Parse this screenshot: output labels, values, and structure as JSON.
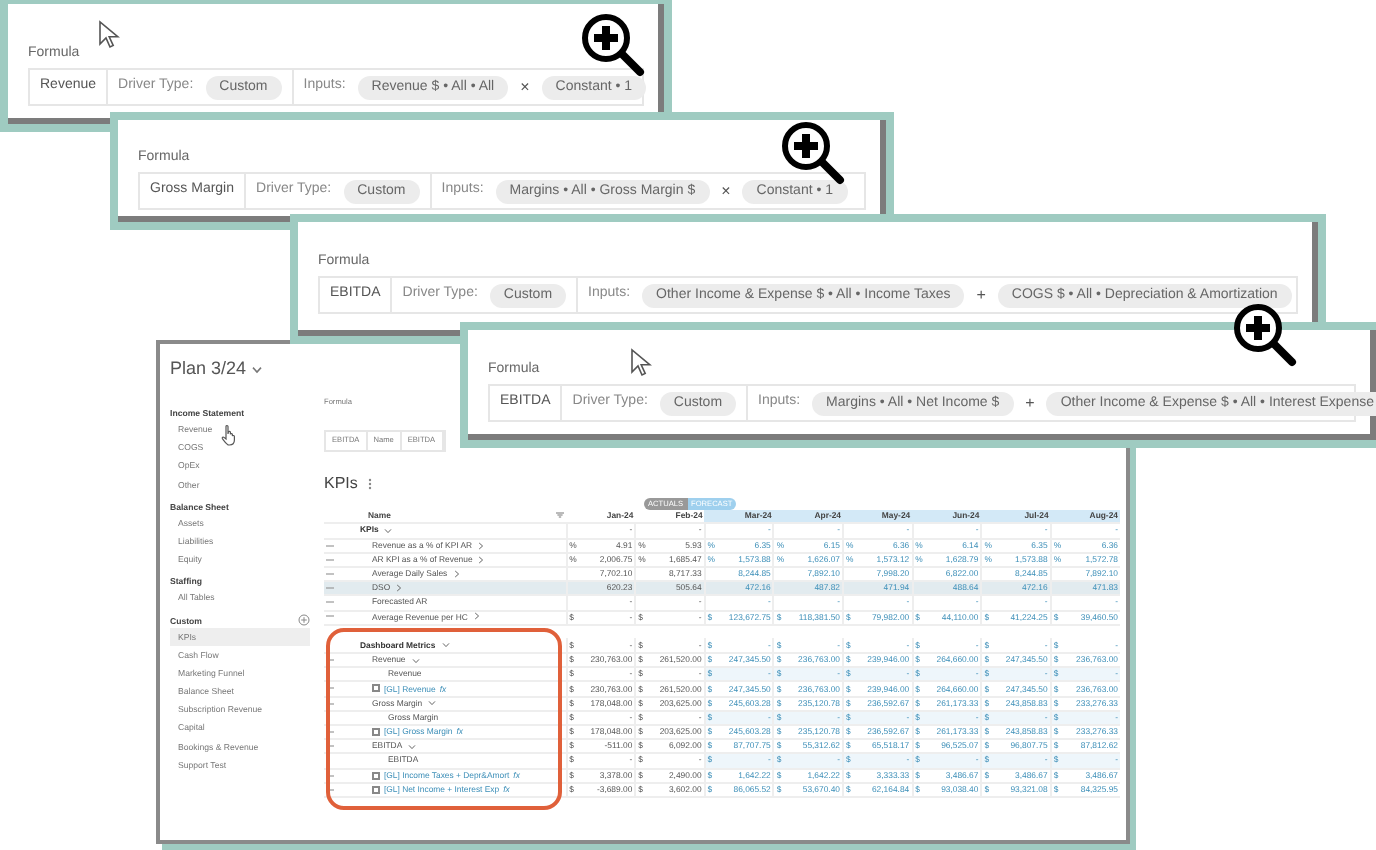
{
  "formula_panels": [
    {
      "title": "Formula",
      "name": "Revenue",
      "driver_label": "Driver Type:",
      "driver_type": "Custom",
      "inputs_label": "Inputs:",
      "inputs": [
        "Revenue $ • All • All",
        "Constant • 1"
      ],
      "operator": "×"
    },
    {
      "title": "Formula",
      "name": "Gross Margin",
      "driver_label": "Driver Type:",
      "driver_type": "Custom",
      "inputs_label": "Inputs:",
      "inputs": [
        "Margins • All • Gross Margin $",
        "Constant • 1"
      ],
      "operator": "×"
    },
    {
      "title": "Formula",
      "name": "EBITDA",
      "driver_label": "Driver Type:",
      "driver_type": "Custom",
      "inputs_label": "Inputs:",
      "inputs": [
        "Other Income & Expense $ • All • Income Taxes",
        "COGS $ • All • Depreciation & Amortization"
      ],
      "operator": "+"
    },
    {
      "title": "Formula",
      "name": "EBITDA",
      "driver_label": "Driver Type:",
      "driver_type": "Custom",
      "inputs_label": "Inputs:",
      "inputs": [
        "Margins • All • Net Income $",
        "Other Income & Expense $ • All • Interest Expense"
      ],
      "operator": "+"
    }
  ],
  "app": {
    "plan_title": "Plan 3/24",
    "sidebar": [
      {
        "heading": "Income Statement",
        "add_button": false,
        "items": [
          {
            "label": "Revenue",
            "selected": false
          },
          {
            "label": "COGS",
            "selected": false
          },
          {
            "label": "OpEx",
            "selected": false
          },
          {
            "label": "Other",
            "selected": false
          }
        ]
      },
      {
        "heading": "Balance Sheet",
        "add_button": false,
        "items": [
          {
            "label": "Assets",
            "selected": false
          },
          {
            "label": "Liabilities",
            "selected": false
          },
          {
            "label": "Equity",
            "selected": false
          }
        ]
      },
      {
        "heading": "Staffing",
        "add_button": false,
        "items": [
          {
            "label": "All Tables",
            "selected": false
          }
        ]
      },
      {
        "heading": "Custom",
        "add_button": true,
        "items": [
          {
            "label": "KPIs",
            "selected": true
          },
          {
            "label": "Cash Flow",
            "selected": false
          },
          {
            "label": "Marketing Funnel",
            "selected": false
          },
          {
            "label": "Balance Sheet",
            "selected": false
          },
          {
            "label": "Subscription Revenue",
            "selected": false
          },
          {
            "label": "Capital",
            "selected": false
          },
          {
            "label": "Bookings & Revenue",
            "selected": false
          },
          {
            "label": "Support Test",
            "selected": false
          }
        ]
      }
    ],
    "formula": {
      "title": "Formula",
      "cells": [
        "EBITDA",
        "Name",
        "EBITDA"
      ]
    },
    "page_title": "KPIs",
    "view_toggle": [
      {
        "label": "ACTUALS",
        "selected": false
      },
      {
        "label": "FORECAST",
        "selected": true
      }
    ],
    "table": {
      "name_column": "Name",
      "columns": [
        {
          "label": "Jan-24",
          "forecast": false
        },
        {
          "label": "Feb-24",
          "forecast": false
        },
        {
          "label": "Mar-24",
          "forecast": true
        },
        {
          "label": "Apr-24",
          "forecast": true
        },
        {
          "label": "May-24",
          "forecast": true
        },
        {
          "label": "Jun-24",
          "forecast": true
        },
        {
          "label": "Jul-24",
          "forecast": true
        },
        {
          "label": "Aug-24",
          "forecast": true
        }
      ],
      "rows": [
        {
          "kind": "section",
          "label": "KPIs",
          "expanded": true,
          "handle": false,
          "selected": false,
          "values": [
            "-",
            "-",
            "-",
            "-",
            "-",
            "-",
            "-",
            "-"
          ],
          "children": [
            {
              "kind": "metric",
              "label": "Revenue as a % of KPI AR",
              "expanded": false,
              "handle": true,
              "selected": false,
              "unit": "%",
              "values": [
                "4.91",
                "5.93",
                "6.35",
                "6.15",
                "6.36",
                "6.14",
                "6.35",
                "6.36"
              ]
            },
            {
              "kind": "metric",
              "label": "AR KPI as a % of Revenue",
              "expanded": false,
              "handle": true,
              "selected": false,
              "unit": "%",
              "values": [
                "2,006.75",
                "1,685.47",
                "1,573.88",
                "1,626.07",
                "1,573.12",
                "1,628.79",
                "1,573.88",
                "1,572.78"
              ]
            },
            {
              "kind": "metric",
              "label": "Average Daily Sales",
              "expanded": false,
              "handle": true,
              "selected": false,
              "values": [
                "7,702.10",
                "8,717.33",
                "8,244.85",
                "7,892.10",
                "7,998.20",
                "6,822.00",
                "8,244.85",
                "7,892.10"
              ]
            },
            {
              "kind": "metric",
              "label": "DSO",
              "expanded": false,
              "handle": true,
              "selected": true,
              "values": [
                "620.23",
                "505.64",
                "472.16",
                "487.82",
                "471.94",
                "488.64",
                "472.16",
                "471.83"
              ]
            },
            {
              "kind": "metric",
              "label": "Forecasted AR",
              "handle": true,
              "selected": false,
              "values": [
                "-",
                "-",
                "-",
                "-",
                "-",
                "-",
                "-",
                "-"
              ]
            },
            {
              "kind": "metric",
              "label": "Average Revenue per HC",
              "expanded": false,
              "handle": true,
              "selected": false,
              "unit": "$",
              "values": [
                "-",
                "-",
                "123,672.75",
                "118,381.50",
                "79,982.00",
                "44,110.00",
                "41,224.25",
                "39,460.50"
              ]
            }
          ]
        },
        {
          "kind": "section",
          "label": "Dashboard Metrics",
          "expanded": true,
          "handle": false,
          "selected": false,
          "unit": "$",
          "values": [
            "-",
            "-",
            "-",
            "-",
            "-",
            "-",
            "-",
            "-"
          ],
          "children": [
            {
              "kind": "metric",
              "label": "Revenue",
              "expanded": true,
              "handle": true,
              "selected": false,
              "unit": "$",
              "values": [
                "230,763.00",
                "261,520.00",
                "247,345.50",
                "236,763.00",
                "239,946.00",
                "264,660.00",
                "247,345.50",
                "236,763.00"
              ],
              "children": [
                {
                  "kind": "label",
                  "label": "Revenue",
                  "handle": false,
                  "selected": false,
                  "unit": "$",
                  "values": [
                    "-",
                    "-",
                    "-",
                    "-",
                    "-",
                    "-",
                    "-",
                    "-"
                  ]
                },
                {
                  "kind": "gl",
                  "label": "[GL] Revenue",
                  "badge": "fx",
                  "checked": false,
                  "handle": true,
                  "selected": false,
                  "unit": "$",
                  "values": [
                    "230,763.00",
                    "261,520.00",
                    "247,345.50",
                    "236,763.00",
                    "239,946.00",
                    "264,660.00",
                    "247,345.50",
                    "236,763.00"
                  ]
                }
              ]
            },
            {
              "kind": "metric",
              "label": "Gross Margin",
              "expanded": true,
              "handle": true,
              "selected": false,
              "unit": "$",
              "values": [
                "178,048.00",
                "203,625.00",
                "245,603.28",
                "235,120.78",
                "236,592.67",
                "261,173.33",
                "243,858.83",
                "233,276.33"
              ],
              "children": [
                {
                  "kind": "label",
                  "label": "Gross Margin",
                  "handle": false,
                  "selected": false,
                  "unit": "$",
                  "values": [
                    "-",
                    "-",
                    "-",
                    "-",
                    "-",
                    "-",
                    "-",
                    "-"
                  ]
                },
                {
                  "kind": "gl",
                  "label": "[GL] Gross Margin",
                  "badge": "fx",
                  "checked": false,
                  "handle": true,
                  "selected": false,
                  "unit": "$",
                  "values": [
                    "178,048.00",
                    "203,625.00",
                    "245,603.28",
                    "235,120.78",
                    "236,592.67",
                    "261,173.33",
                    "243,858.83",
                    "233,276.33"
                  ]
                }
              ]
            },
            {
              "kind": "metric",
              "label": "EBITDA",
              "expanded": true,
              "handle": true,
              "selected": false,
              "unit": "$",
              "values": [
                "-511.00",
                "6,092.00",
                "87,707.75",
                "55,312.62",
                "65,518.17",
                "96,525.07",
                "96,807.75",
                "87,812.62"
              ],
              "children": [
                {
                  "kind": "label",
                  "label": "EBITDA",
                  "handle": false,
                  "selected": false,
                  "unit": "$",
                  "values": [
                    "-",
                    "-",
                    "-",
                    "-",
                    "-",
                    "-",
                    "-",
                    "-"
                  ]
                },
                {
                  "kind": "gl",
                  "label": "[GL] Income Taxes + Depr&Amort",
                  "badge": "fx",
                  "checked": false,
                  "handle": true,
                  "selected": false,
                  "unit": "$",
                  "values": [
                    "3,378.00",
                    "2,490.00",
                    "1,642.22",
                    "1,642.22",
                    "3,333.33",
                    "3,486.67",
                    "3,486.67",
                    "3,486.67"
                  ]
                },
                {
                  "kind": "gl",
                  "label": "[GL] Net Income + Interest Exp",
                  "badge": "fx",
                  "checked": false,
                  "handle": true,
                  "selected": false,
                  "unit": "$",
                  "values": [
                    "-3,689.00",
                    "3,602.00",
                    "86,065.52",
                    "53,670.40",
                    "62,164.84",
                    "93,038.40",
                    "93,321.08",
                    "84,325.95"
                  ]
                }
              ]
            }
          ]
        }
      ]
    }
  }
}
